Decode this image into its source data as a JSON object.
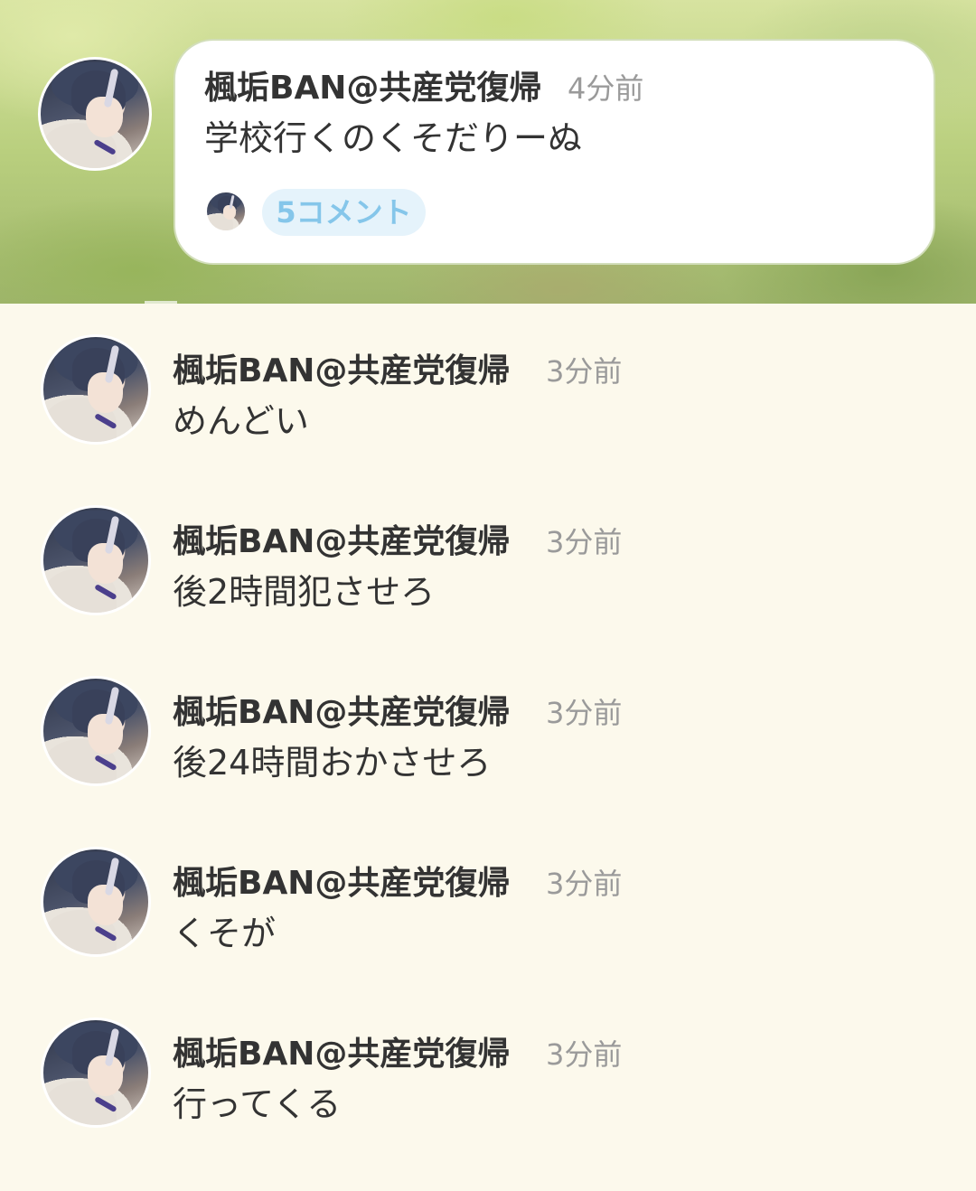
{
  "post": {
    "author": "楓垢BAN@共産党復帰",
    "time": "4分前",
    "message": "学校行くのくそだりーぬ",
    "comment_count_label": "5コメント"
  },
  "comments": [
    {
      "author": "楓垢BAN@共産党復帰",
      "time": "3分前",
      "message": "めんどい"
    },
    {
      "author": "楓垢BAN@共産党復帰",
      "time": "3分前",
      "message": "後2時間犯させろ"
    },
    {
      "author": "楓垢BAN@共産党復帰",
      "time": "3分前",
      "message": "後24時間おかさせろ"
    },
    {
      "author": "楓垢BAN@共産党復帰",
      "time": "3分前",
      "message": "くそが"
    },
    {
      "author": "楓垢BAN@共産党復帰",
      "time": "3分前",
      "message": "行ってくる"
    }
  ],
  "colors": {
    "background": "#fcf9ec",
    "name": "#333333",
    "time": "#9a9a9a",
    "comment_chip_bg": "#e5f3fb",
    "comment_chip_text": "#85c6ea"
  }
}
